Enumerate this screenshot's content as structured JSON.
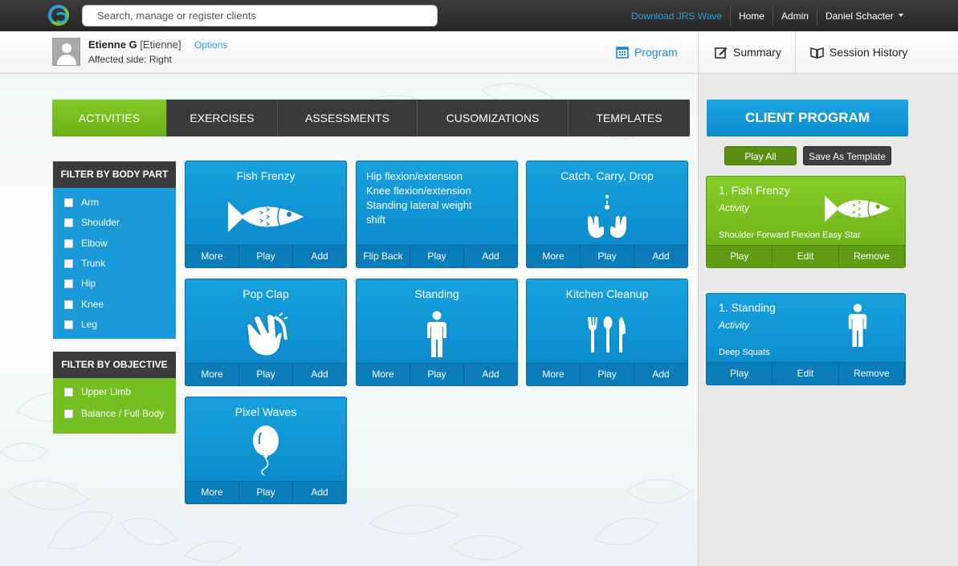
{
  "topbar": {
    "search_placeholder": "Search, manage or register clients",
    "links": {
      "download": "Download JRS Wave",
      "home": "Home",
      "admin": "Admin",
      "user": "Daniel Schacter"
    }
  },
  "client": {
    "name": "Etienne G",
    "alias": "[Etienne]",
    "options_label": "Options",
    "affected_side": "Affected side: Right"
  },
  "views": {
    "program": "Program",
    "summary": "Summary",
    "history": "Session History"
  },
  "tabs": [
    "ACTIVITIES",
    "EXERCISES",
    "ASSESSMENTS",
    "CUSOMIZATIONS",
    "TEMPLATES"
  ],
  "filters": {
    "body_title": "FILTER BY BODY PART",
    "body_parts": [
      "Arm",
      "Shoulder",
      "Elbow",
      "Trunk",
      "Hip",
      "Knee",
      "Leg"
    ],
    "objective_title": "FILTER BY OBJECTIVE",
    "objectives": [
      "Upper Limb",
      "Balance / Full Body"
    ]
  },
  "cards": [
    {
      "title": "Fish Frenzy",
      "icon": "fish-icon",
      "buttons": [
        "More",
        "Play",
        "Add"
      ]
    },
    {
      "lines": [
        "Hip flexion/extension",
        "Knee flexion/extension",
        "Standing lateral weight",
        "shift"
      ],
      "buttons": [
        "Flip Back",
        "Play",
        "Add"
      ]
    },
    {
      "title": "Catch. Carry, Drop",
      "icon": "hands-catch-icon",
      "buttons": [
        "More",
        "Play",
        "Add"
      ]
    },
    {
      "title": "Pop Clap",
      "icon": "clap-icon",
      "buttons": [
        "More",
        "Play",
        "Add"
      ]
    },
    {
      "title": "Standing",
      "icon": "standing-person-icon",
      "buttons": [
        "More",
        "Play",
        "Add"
      ]
    },
    {
      "title": "Kitchen Cleanup",
      "icon": "cutlery-icon",
      "buttons": [
        "More",
        "Play",
        "Add"
      ]
    },
    {
      "title": "Pixel Waves",
      "icon": "balloon-icon",
      "buttons": [
        "More",
        "Play",
        "Add"
      ]
    }
  ],
  "program": {
    "title": "CLIENT PROGRAM",
    "play_all": "Play All",
    "save_template": "Save As Template",
    "items": [
      {
        "title": "1. Fish Frenzy",
        "type": "Activity",
        "detail": "Shoulder Forward Flexion Easy Star",
        "icon": "fish-icon",
        "buttons": [
          "Play",
          "Edit",
          "Remove"
        ]
      },
      {
        "title": "1. Standing",
        "type": "Activity",
        "detail": "Deep Squats",
        "icon": "standing-person-icon",
        "buttons": [
          "Play",
          "Edit",
          "Remove"
        ]
      }
    ]
  },
  "colors": {
    "accent_blue": "#1a9ad9",
    "accent_green": "#74bf22",
    "dark": "#3a3a3a"
  }
}
